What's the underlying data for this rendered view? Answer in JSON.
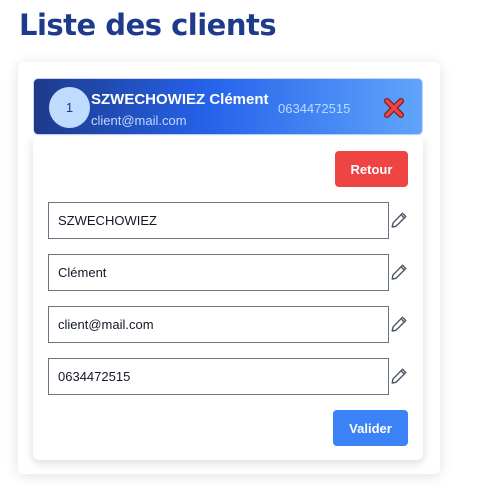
{
  "page": {
    "title": "Liste des clients"
  },
  "client": {
    "index": "1",
    "name": "SZWECHOWIEZ Clément",
    "email": "client@mail.com",
    "phone": "0634472515",
    "delete_icon": "close-x-icon"
  },
  "actions": {
    "back_label": "Retour",
    "submit_label": "Valider"
  },
  "form": {
    "fields": [
      {
        "name": "last_name",
        "value": "SZWECHOWIEZ",
        "icon": "pencil-icon"
      },
      {
        "name": "first_name",
        "value": "Clément",
        "icon": "pencil-icon"
      },
      {
        "name": "email",
        "value": "client@mail.com",
        "icon": "pencil-icon"
      },
      {
        "name": "phone",
        "value": "0634472515",
        "icon": "pencil-icon"
      }
    ]
  },
  "colors": {
    "title": "#1e3a8a",
    "header_gradient_start": "#1e3a8a",
    "header_gradient_end": "#60a5fa",
    "back_button": "#ef4444",
    "submit_button": "#3b82f6",
    "delete_icon_fill": "#ef4444"
  }
}
